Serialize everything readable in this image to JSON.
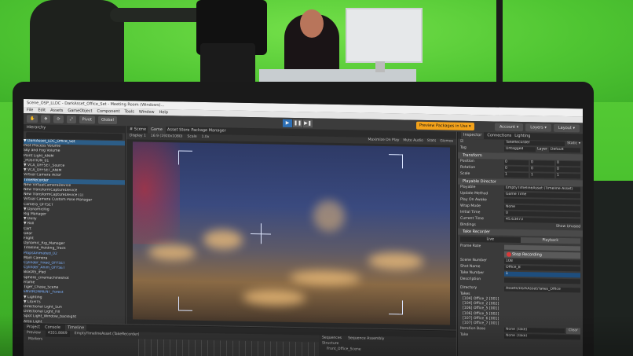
{
  "window": {
    "title": "Scene_OSP_LLDC - DarkAsset_Office_Set - Meeting Room (Windows)..."
  },
  "menu": [
    "File",
    "Edit",
    "Assets",
    "GameObject",
    "Component",
    "Tools",
    "Window",
    "Help"
  ],
  "toolbar": {
    "buttons": [
      "Pivot",
      "Global"
    ],
    "preview_badge": "Preview Packages in Use ▾",
    "right_dropdowns": [
      "Account ▾",
      "Layers ▾",
      "Layout ▾"
    ]
  },
  "hierarchy": {
    "tab": "Hierarchy",
    "items": [
      {
        "label": "▼ DarkAsset_LDC_Office_Set",
        "sel": true,
        "blue": false
      },
      {
        "label": "  Post Process Volume",
        "sel": false,
        "blue": false
      },
      {
        "label": "  Sky and Fog Volume",
        "sel": false,
        "blue": false
      },
      {
        "label": "  Point Light_ANIM",
        "sel": false,
        "blue": false
      },
      {
        "label": "  _POSITION_01",
        "sel": false,
        "blue": false
      },
      {
        "label": "  ▼ VCA_OFFSET_Source",
        "sel": false,
        "blue": false
      },
      {
        "label": "  ▼ VCA_OFFSET_ANIM",
        "sel": false,
        "blue": false
      },
      {
        "label": "     Virtual Camera Actor",
        "sel": false,
        "blue": false
      },
      {
        "label": "  TimeRecorder",
        "sel": true,
        "blue": false
      },
      {
        "label": "     New VirtualCameraDevice",
        "sel": false,
        "blue": false
      },
      {
        "label": "     New TransformCaptureDevice",
        "sel": false,
        "blue": false
      },
      {
        "label": "     New TransformCaptureDevice (1)",
        "sel": false,
        "blue": false
      },
      {
        "label": "  Virtual Camera Custom Pose Manager",
        "sel": false,
        "blue": false
      },
      {
        "label": "  Camera_OFFSET",
        "sel": false,
        "blue": false
      },
      {
        "label": "  ▼ DynamicRig",
        "sel": false,
        "blue": false
      },
      {
        "label": "     Rig Manager",
        "sel": false,
        "blue": false
      },
      {
        "label": "     ▼ Dolly",
        "sel": false,
        "blue": false
      },
      {
        "label": "     ▼ Roll",
        "sel": false,
        "blue": false
      },
      {
        "label": "        Cart",
        "sel": false,
        "blue": false
      },
      {
        "label": "        Gear",
        "sel": false,
        "blue": false
      },
      {
        "label": "        Flight",
        "sel": false,
        "blue": false
      },
      {
        "label": "  Dynamic_Rig_Manager",
        "sel": false,
        "blue": false
      },
      {
        "label": "  Timeline_Holding_Track",
        "sel": false,
        "blue": false
      },
      {
        "label": "  PropsAnimated_02",
        "sel": false,
        "blue": true
      },
      {
        "label": "  Main Camera",
        "sel": false,
        "blue": false
      },
      {
        "label": "  Cylinder_Fixed_OFFSET",
        "sel": false,
        "blue": true
      },
      {
        "label": "  Cylinder_Anim_OFFSET",
        "sel": false,
        "blue": true
      },
      {
        "label": "  BoxDIS_iPad",
        "sel": false,
        "blue": false
      },
      {
        "label": "  Sphere_cinemachineshot",
        "sel": false,
        "blue": false
      },
      {
        "label": "  Frame",
        "sel": false,
        "blue": false
      },
      {
        "label": "  Tiger_Chase_Scene",
        "sel": false,
        "blue": false
      },
      {
        "label": "  ENVIRONMENT_Forest",
        "sel": false,
        "blue": true
      },
      {
        "label": "  ▼ Lighting",
        "sel": false,
        "blue": false
      },
      {
        "label": "  ▼ LIGHTS",
        "sel": false,
        "blue": false
      },
      {
        "label": "     Directional Light_Sun",
        "sel": false,
        "blue": false
      },
      {
        "label": "     Directional Light_Fill",
        "sel": false,
        "blue": false
      },
      {
        "label": "     Spot Light_Window_backlight",
        "sel": false,
        "blue": false
      },
      {
        "label": "     Area Light",
        "sel": false,
        "blue": false
      }
    ]
  },
  "scene": {
    "tabs": [
      "# Scene",
      "Game",
      "Asset Store",
      "Package Manager"
    ],
    "bar_left": [
      "Display 1",
      "16:9 (1920x1080)",
      "Scale",
      "1.0x"
    ],
    "bar_right": [
      "Maximize On Play",
      "Mute Audio",
      "Stats",
      "Gizmos"
    ]
  },
  "inspector": {
    "tabs": [
      "Inspector",
      "Connections",
      "Lighting"
    ],
    "object_name": "TakeRecorder",
    "static_label": "Static ▾",
    "tag": "Untagged",
    "layer": "Default",
    "transform": {
      "header": "Transform",
      "position": [
        "0",
        "0",
        "0"
      ],
      "rotation": [
        "0",
        "0",
        "0"
      ],
      "scale": [
        "1",
        "1",
        "1"
      ]
    },
    "playable": {
      "header": "Playable Director",
      "rows": [
        {
          "label": "Playable",
          "value": "EmptyTimelineAsset (Timeline Asset)"
        },
        {
          "label": "Update Method",
          "value": "Game Time"
        },
        {
          "label": "Play On Awake",
          "value": ""
        },
        {
          "label": "Wrap Mode",
          "value": "None"
        },
        {
          "label": "Initial Time",
          "value": "0"
        },
        {
          "label": "Current Time",
          "value": "45.63473"
        }
      ],
      "bindings": "Bindings",
      "show_unused": "Show Unused"
    },
    "recorder": {
      "header": "Take Recorder",
      "modes": [
        "Live",
        "Playback"
      ],
      "frame_rate_label": "Frame Rate",
      "stop_button": "Stop Recording",
      "rows": [
        {
          "label": "Scene Number",
          "value": "108"
        },
        {
          "label": "Shot Name",
          "value": "Office_8"
        },
        {
          "label": "Take Number",
          "value": "1"
        },
        {
          "label": "Description",
          "value": ""
        }
      ],
      "directory_label": "Directory",
      "directory_value": "Assets/DarkAsset/Takes_Office",
      "takes_label": "Takes",
      "takes": [
        "[104] Office_2 [001]",
        "[104] Office_2 [002]",
        "[106] Office_5 [001]",
        "[106] Office_5 [002]",
        "[107] Office_6 [001]",
        "[107] Office_7 [001]"
      ],
      "iteration_base": "Iteration Base",
      "iteration_value": "None (Take)",
      "take_label": "Take",
      "take_value": "None (Take)",
      "clear_button": "Clear"
    }
  },
  "bottom": {
    "tabs": [
      "Project",
      "Console",
      "Timeline"
    ],
    "preview": "Preview",
    "frame_counter": "4331.8869",
    "timeline_asset": "EmptyTimelineAsset (TakeRecorder)",
    "markers": "Markers",
    "sequences_tab": "Sequences",
    "sequence_asm_tab": "Sequence Assembly",
    "structure_label": "Structure",
    "structure_item": "Front_Office_Scene"
  }
}
